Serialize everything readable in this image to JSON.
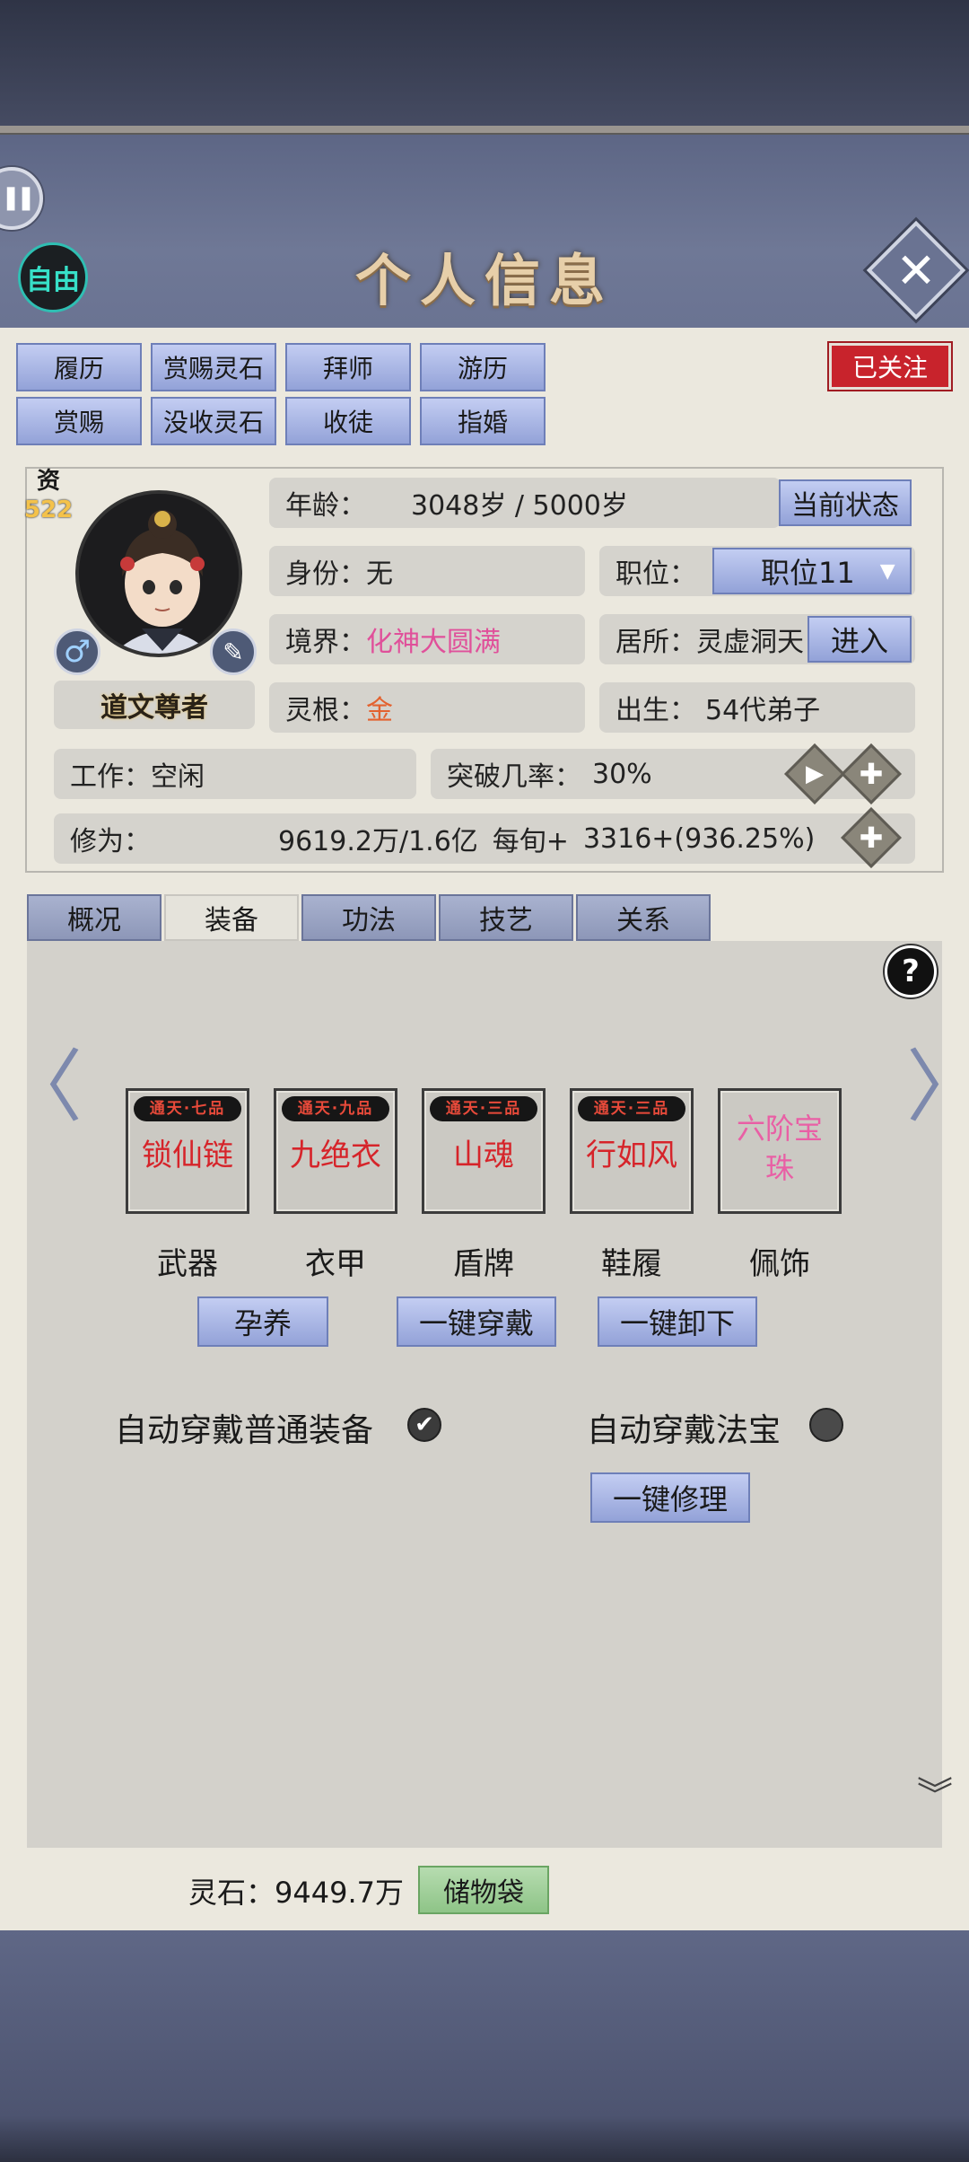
{
  "header": {
    "title": "个人信息",
    "free_label": "自由",
    "pause_glyph": "▌▌",
    "close_glyph": "✕"
  },
  "actions_row1": [
    "履历",
    "赏赐灵石",
    "拜师",
    "游历"
  ],
  "actions_row2": [
    "赏赐",
    "没收灵石",
    "收徒",
    "指婚"
  ],
  "follow_label": "已关注",
  "profile": {
    "resource_label": "资",
    "resource_value": "522",
    "name": "道文尊者",
    "age_label": "年龄：",
    "age_value": "3048岁 / 5000岁",
    "status_button": "当前状态",
    "identity_label": "身份：",
    "identity_value": "无",
    "position_label": "职位：",
    "position_value": "职位11",
    "realm_label": "境界：",
    "realm_value": "化神大圆满",
    "residence_label": "居所：",
    "residence_value": "灵虚洞天",
    "enter_button": "进入",
    "root_label": "灵根：",
    "root_value": "金",
    "birth_label": "出生：",
    "birth_value": "54代弟子",
    "work_label": "工作：",
    "work_value": "空闲",
    "breakthrough_label": "突破几率：",
    "breakthrough_value": "30%",
    "cultivation_label": "修为：",
    "cultivation_value": "9619.2万/1.6亿",
    "per_turn_label": "每旬+",
    "per_turn_value": "3316+(936.25%)"
  },
  "tabs": [
    "概况",
    "装备",
    "功法",
    "技艺",
    "关系"
  ],
  "equipment": [
    {
      "tag": "通天·七品",
      "name": "锁仙链",
      "slot": "武器"
    },
    {
      "tag": "通天·九品",
      "name": "九绝衣",
      "slot": "衣甲"
    },
    {
      "tag": "通天·三品",
      "name": "山魂",
      "slot": "盾牌"
    },
    {
      "tag": "通天·三品",
      "name": "行如风",
      "slot": "鞋履"
    },
    {
      "tag": "",
      "name": "六阶宝珠",
      "slot": "佩饰"
    }
  ],
  "equip_buttons": {
    "nurture": "孕养",
    "wear_all": "一键穿戴",
    "remove_all": "一键卸下",
    "repair_all": "一键修理"
  },
  "auto_options": {
    "normal_label": "自动穿戴普通装备",
    "normal_checked": true,
    "treasure_label": "自动穿戴法宝",
    "treasure_checked": false
  },
  "footer": {
    "stones_label": "灵石：9449.7万",
    "storage_button": "储物袋"
  },
  "icons": {
    "left_arrow": "〈",
    "right_arrow": "〉",
    "help": "?",
    "play": "▶",
    "plus": "✚",
    "dropdown": "▼",
    "male": "♂",
    "pen": "✎",
    "check": "✔",
    "collapse": "︾"
  },
  "colors": {
    "accent_blue": "#93a2d8",
    "red_badge": "#c8232c",
    "pink_text": "#e0509a",
    "orange_text": "#e3622f",
    "equip_red": "#d6242a"
  }
}
